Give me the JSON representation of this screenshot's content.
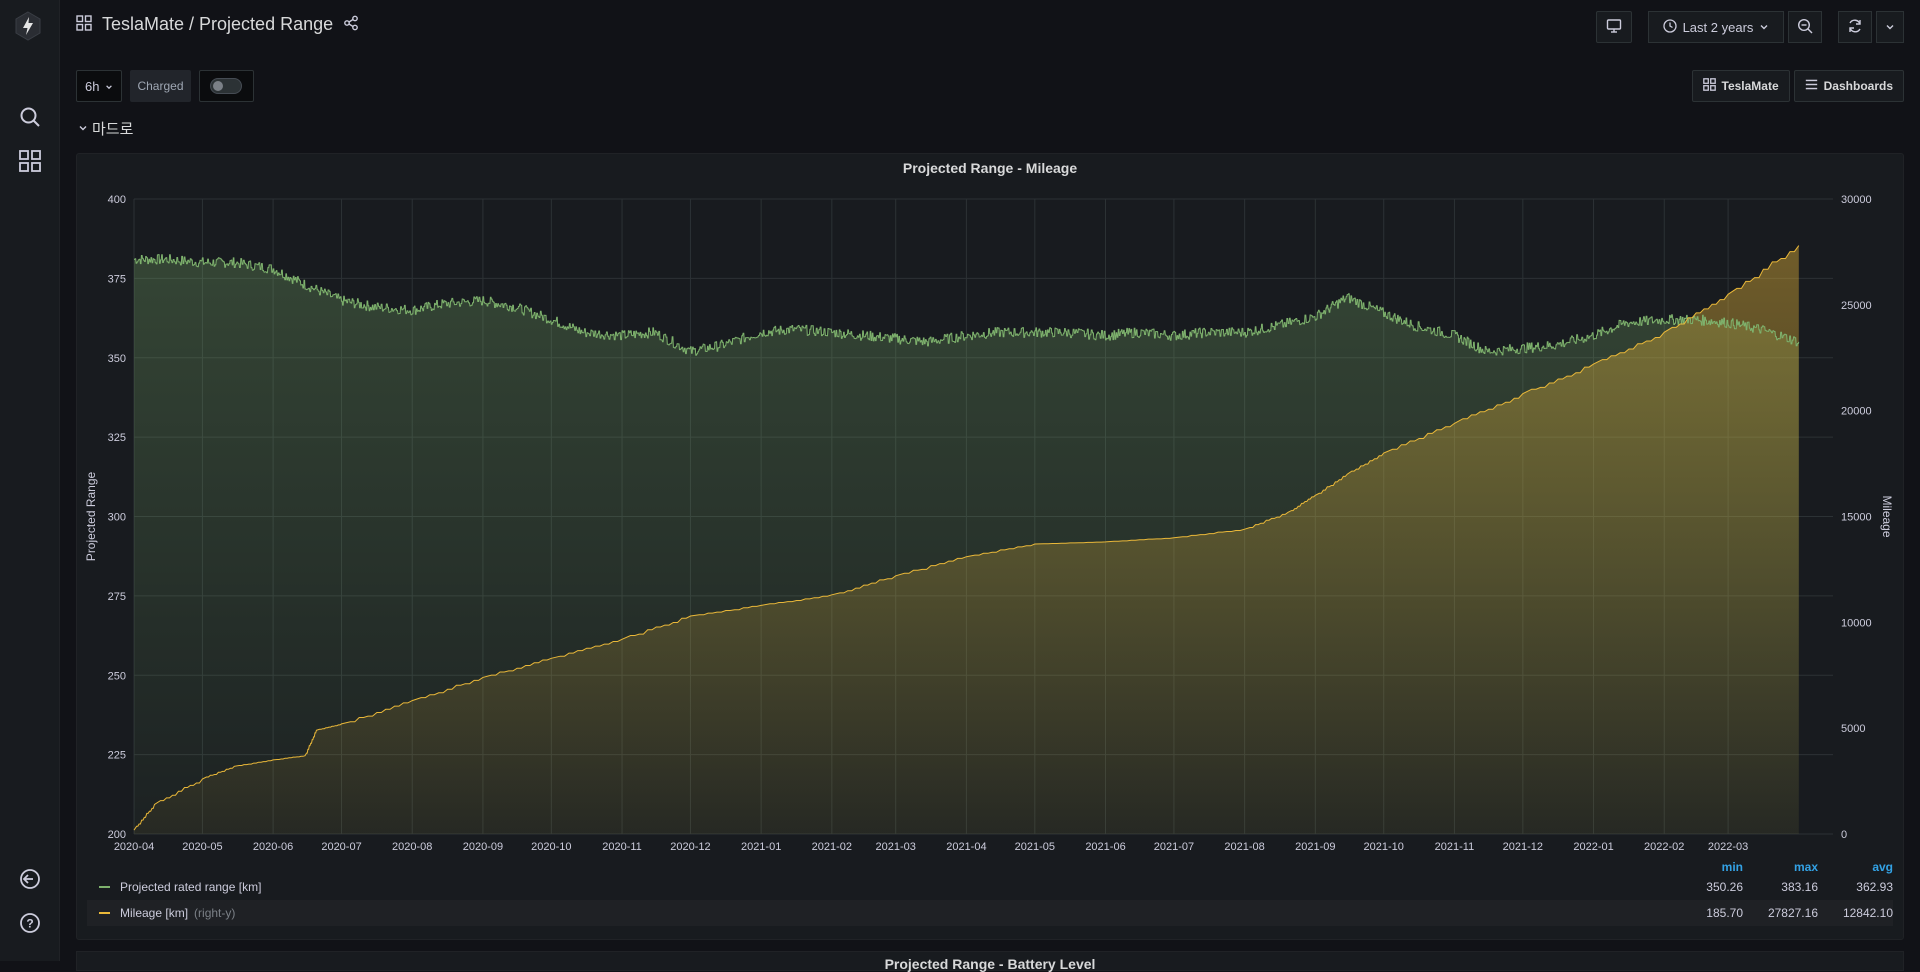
{
  "app": {
    "title": "TeslaMate / Projected Range"
  },
  "sidebar": {
    "items": [
      {
        "icon": "search-icon"
      },
      {
        "icon": "dashboards-icon"
      }
    ],
    "bottom": [
      {
        "icon": "sign-in-icon"
      },
      {
        "icon": "help-icon"
      }
    ]
  },
  "toolbar": {
    "time_range": "Last 2 years"
  },
  "variables": {
    "interval": "6h",
    "charged_label": "Charged"
  },
  "links": {
    "teslamate": "TeslaMate",
    "dashboards": "Dashboards"
  },
  "row": {
    "title": "마드로"
  },
  "panel": {
    "title": "Projected Range - Mileage",
    "legend": {
      "headers": [
        "min",
        "max",
        "avg"
      ],
      "series": [
        {
          "name": "Projected rated range [km]",
          "axis": "",
          "color": "#7eb26d",
          "min": "350.26",
          "max": "383.16",
          "avg": "362.93"
        },
        {
          "name": "Mileage [km]",
          "axis": "(right-y)",
          "color": "#eab839",
          "min": "185.70",
          "max": "27827.16",
          "avg": "12842.10"
        }
      ]
    }
  },
  "next_panel": {
    "title": "Projected Range - Battery Level"
  },
  "chart_data": {
    "type": "line",
    "title": "Projected Range - Mileage",
    "ylabel": "Projected Range",
    "y2label": "Mileage",
    "ylim": [
      200,
      400
    ],
    "y2lim": [
      0,
      30000
    ],
    "yticks": [
      "400",
      "375",
      "350",
      "325",
      "300",
      "275",
      "250",
      "225",
      "200"
    ],
    "y2ticks": [
      "30000",
      "25000",
      "20000",
      "15000",
      "10000",
      "5000",
      "0"
    ],
    "xticks": [
      "2020-04",
      "2020-05",
      "2020-06",
      "2020-07",
      "2020-08",
      "2020-09",
      "2020-10",
      "2020-11",
      "2020-12",
      "2021-01",
      "2021-02",
      "2021-03",
      "2021-04",
      "2021-05",
      "2021-06",
      "2021-07",
      "2021-08",
      "2021-09",
      "2021-10",
      "2021-11",
      "2021-12",
      "2022-01",
      "2022-02",
      "2022-03"
    ],
    "series": [
      {
        "name": "Projected rated range [km]",
        "axis": "left",
        "color": "#7eb26d",
        "x": [
          "2020-04-01",
          "2020-04-15",
          "2020-05-01",
          "2020-05-15",
          "2020-06-01",
          "2020-06-15",
          "2020-07-01",
          "2020-07-15",
          "2020-08-01",
          "2020-08-15",
          "2020-09-01",
          "2020-09-15",
          "2020-10-01",
          "2020-10-15",
          "2020-11-01",
          "2020-11-15",
          "2020-12-01",
          "2020-12-15",
          "2021-01-01",
          "2021-01-15",
          "2021-02-01",
          "2021-02-15",
          "2021-03-01",
          "2021-03-15",
          "2021-04-01",
          "2021-04-15",
          "2021-05-01",
          "2021-05-15",
          "2021-06-01",
          "2021-06-15",
          "2021-07-01",
          "2021-07-15",
          "2021-08-01",
          "2021-08-15",
          "2021-09-01",
          "2021-09-15",
          "2021-10-01",
          "2021-10-15",
          "2021-11-01",
          "2021-11-15",
          "2021-12-01",
          "2021-12-15",
          "2022-01-01",
          "2022-01-15",
          "2022-02-01",
          "2022-02-15",
          "2022-03-01",
          "2022-03-15",
          "2022-04-01"
        ],
        "values": [
          381,
          381,
          380,
          380,
          378,
          373,
          368,
          366,
          365,
          367,
          368,
          366,
          362,
          358,
          357,
          358,
          352,
          354,
          358,
          359,
          358,
          357,
          356,
          355,
          357,
          358,
          358,
          358,
          357,
          358,
          357,
          358,
          358,
          360,
          363,
          369,
          364,
          360,
          357,
          352,
          353,
          354,
          357,
          361,
          362,
          362,
          361,
          359,
          355
        ]
      },
      {
        "name": "Mileage [km]",
        "axis": "right",
        "color": "#eab839",
        "x": [
          "2020-04-01",
          "2020-04-10",
          "2020-05-01",
          "2020-05-15",
          "2020-06-01",
          "2020-06-15",
          "2020-06-20",
          "2020-07-01",
          "2020-08-01",
          "2020-09-01",
          "2020-10-01",
          "2020-11-01",
          "2020-12-01",
          "2021-01-01",
          "2021-02-01",
          "2021-03-01",
          "2021-04-01",
          "2021-05-01",
          "2021-06-01",
          "2021-07-01",
          "2021-08-01",
          "2021-08-20",
          "2021-09-01",
          "2021-09-15",
          "2021-10-01",
          "2021-11-01",
          "2021-12-01",
          "2022-01-01",
          "2022-02-01",
          "2022-03-01",
          "2022-04-01"
        ],
        "values": [
          186,
          1400,
          2600,
          3200,
          3500,
          3700,
          4900,
          5200,
          6300,
          7400,
          8300,
          9200,
          10300,
          10800,
          11300,
          12200,
          13100,
          13700,
          13800,
          14000,
          14400,
          15200,
          16000,
          17000,
          18000,
          19400,
          20800,
          22200,
          23700,
          25500,
          27800
        ]
      }
    ]
  }
}
